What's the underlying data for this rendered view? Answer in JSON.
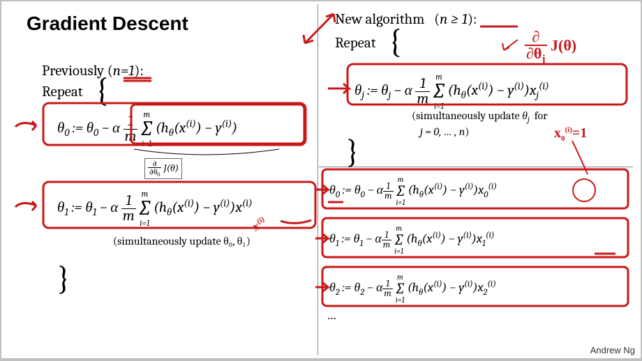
{
  "title": "Gradient Descent",
  "author": "Andrew Ng",
  "left": {
    "header_pre": "Previously ",
    "header_cond": "n=1",
    "header_post": ":",
    "repeat": "Repeat",
    "eq0": {
      "sum_top": "m",
      "sum_bot": "i=1"
    },
    "eq1": {
      "sum_top": "m",
      "sum_bot": "i=1"
    },
    "note": "(simultaneously update θ₀, θ₁)"
  },
  "right": {
    "header_label": "New algorithm",
    "header_cond": "n ≥ 1",
    "header_post": ":",
    "repeat": "Repeat",
    "eqj": {
      "sum_top": "m",
      "sum_bot": "i=1"
    },
    "note_pre": "simultaneously update",
    "note_for": "for",
    "note_range": "j = 0, … , n",
    "note_post": ")",
    "eq0": {
      "sum_top": "m",
      "sum_bot": "i=1"
    },
    "eq1": {
      "sum_top": "m",
      "sum_bot": "i=1"
    },
    "eq2": {
      "sum_top": "m",
      "sum_bot": "i=1"
    },
    "more": "…"
  },
  "annotations": {
    "partial_deriv_right": "∂/∂θⱼ J(θ)",
    "x0_equals_1": "x₀^(i) = 1",
    "xi_label": "x^(i)",
    "partial_box_left": "∂/∂θ₀ J(θ)"
  },
  "colors": {
    "ink_red": "#c81818"
  }
}
